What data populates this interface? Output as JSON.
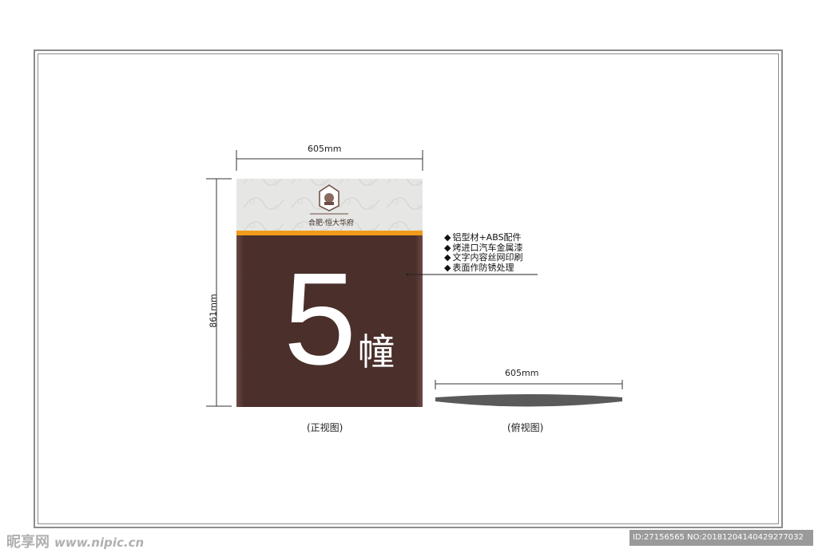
{
  "drawing": {
    "width_label_front": "605mm",
    "width_label_top": "605mm",
    "height_label": "861mm",
    "sign": {
      "logo_text": "合肥·恒大华府",
      "number": "5",
      "unit": "幢",
      "panel_color": "#4a2f2b",
      "header_color": "#e6e6e4",
      "accent_stripe_color": "#f09a1a"
    },
    "specs": [
      "铝型材+ABS配件",
      "烤进口汽车金属漆",
      "文字内容丝网印刷",
      "表面作防锈处理"
    ],
    "captions": {
      "front": "(正视图)",
      "top": "(俯视图)"
    }
  },
  "watermark": {
    "brand": "昵享网",
    "url": "www.nipic.cn",
    "id_text": "ID:27156565 NO:20181204140429277032"
  }
}
